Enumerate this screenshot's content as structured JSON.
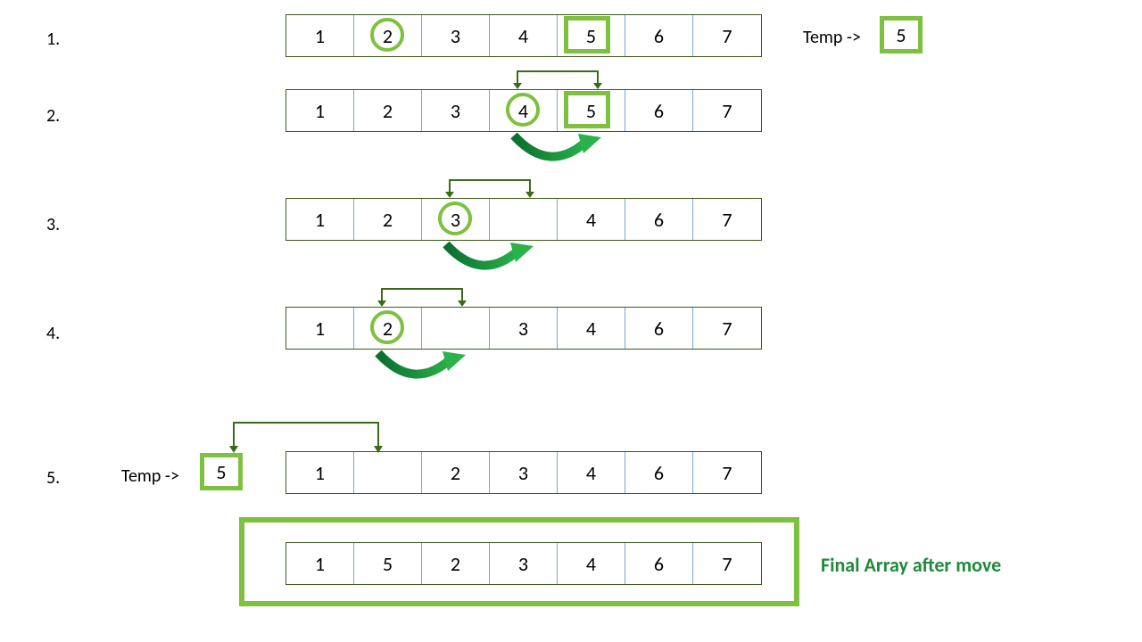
{
  "steps": {
    "s1": {
      "label": "1.",
      "cells": [
        "1",
        "2",
        "3",
        "4",
        "5",
        "6",
        "7"
      ]
    },
    "s2": {
      "label": "2.",
      "cells": [
        "1",
        "2",
        "3",
        "4",
        "5",
        "6",
        "7"
      ]
    },
    "s3": {
      "label": "3.",
      "cells": [
        "1",
        "2",
        "3",
        "",
        "4",
        "6",
        "7"
      ]
    },
    "s4": {
      "label": "4.",
      "cells": [
        "1",
        "2",
        "",
        "3",
        "4",
        "6",
        "7"
      ]
    },
    "s5": {
      "label": "5.",
      "cells": [
        "1",
        "",
        "2",
        "3",
        "4",
        "6",
        "7"
      ]
    },
    "final": {
      "cells": [
        "1",
        "5",
        "2",
        "3",
        "4",
        "6",
        "7"
      ]
    }
  },
  "temp": {
    "label": "Temp ->",
    "value": "5"
  },
  "final_label": "Final Array after move",
  "colors": {
    "cell_border": "#3b5b1a",
    "cell_divider": "#7aa6d6",
    "highlight": "#7ec03f",
    "arrow_dark": "#3b6b1a",
    "arrow_green": "#0f8a3b",
    "final_text": "#1f8a3b"
  }
}
